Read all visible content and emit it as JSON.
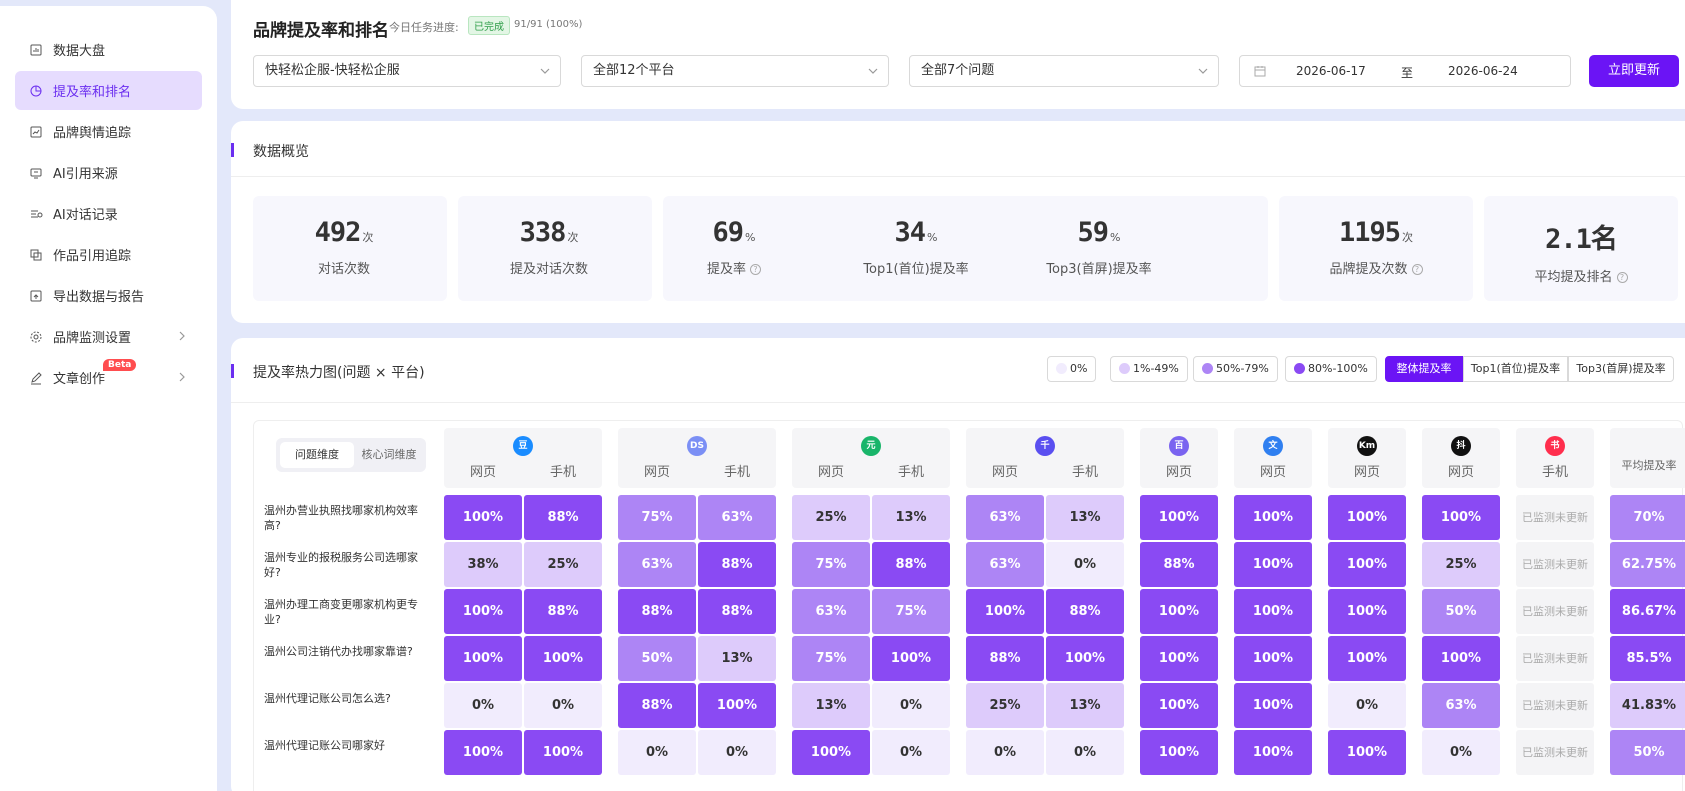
{
  "sidebar": {
    "items": [
      {
        "label": "数据大盘",
        "icon": "dashboard-icon",
        "active": false
      },
      {
        "label": "提及率和排名",
        "icon": "pie-chart-icon",
        "active": true
      },
      {
        "label": "品牌舆情追踪",
        "icon": "trend-icon",
        "active": false
      },
      {
        "label": "AI引用来源",
        "icon": "monitor-icon",
        "active": false
      },
      {
        "label": "AI对话记录",
        "icon": "chat-icon",
        "active": false
      },
      {
        "label": "作品引用追踪",
        "icon": "copy-icon",
        "active": false
      },
      {
        "label": "导出数据与报告",
        "icon": "export-icon",
        "active": false
      },
      {
        "label": "品牌监测设置",
        "icon": "gear-icon",
        "active": false,
        "has_children": true
      },
      {
        "label": "文章创作",
        "icon": "pen-icon",
        "active": false,
        "has_children": true,
        "badge": "Beta"
      }
    ]
  },
  "header": {
    "title": "品牌提及率和排名",
    "progress_label": "今日任务进度:",
    "status_badge": "已完成",
    "progress_value": "91/91 (100%)",
    "brand_select": "快轻松企服-快轻松企服",
    "platform_select": "全部12个平台",
    "question_select": "全部7个问题",
    "date_start": "2026-06-17",
    "date_sep": "至",
    "date_end": "2026-06-24",
    "update_button": "立即更新"
  },
  "overview": {
    "title": "数据概览",
    "stats": [
      {
        "value": "492",
        "unit": "次",
        "label": "对话次数",
        "help": false
      },
      {
        "value": "338",
        "unit": "次",
        "label": "提及对话次数",
        "help": false
      },
      {
        "value": "69",
        "unit": "%",
        "label": "提及率",
        "help": true
      },
      {
        "value": "34",
        "unit": "%",
        "label": "Top1(首位)提及率",
        "help": false
      },
      {
        "value": "59",
        "unit": "%",
        "label": "Top3(首屏)提及率",
        "help": false
      },
      {
        "value": "1195",
        "unit": "次",
        "label": "品牌提及次数",
        "help": true
      },
      {
        "value": "2.1名",
        "unit": "",
        "label": "平均提及排名",
        "help": true
      }
    ]
  },
  "heatmap": {
    "title": "提及率热力图(问题 × 平台)",
    "legend": [
      {
        "label": "0%",
        "color": "#f1ecfd"
      },
      {
        "label": "1%-49%",
        "color": "#ddcbfb"
      },
      {
        "label": "50%-79%",
        "color": "#ad85f5"
      },
      {
        "label": "80%-100%",
        "color": "#8a4af3"
      }
    ],
    "metric_tabs": [
      "整体提及率",
      "Top1(首位)提及率",
      "Top3(首屏)提及率"
    ],
    "dimension_tabs": [
      "问题维度",
      "核心词维度"
    ],
    "col_web": "网页",
    "col_mobile": "手机",
    "avg_header": "平均提及率",
    "not_monitored": "已监测未更新",
    "platforms": [
      {
        "logo": "豆",
        "color": "#1a8cff",
        "cols": [
          "网页",
          "手机"
        ]
      },
      {
        "logo": "DS",
        "color": "#7b8ff5",
        "cols": [
          "网页",
          "手机"
        ]
      },
      {
        "logo": "元",
        "color": "#19b56a",
        "cols": [
          "网页",
          "手机"
        ]
      },
      {
        "logo": "千",
        "color": "#5a4ff0",
        "cols": [
          "网页",
          "手机"
        ]
      },
      {
        "logo": "百",
        "color": "#7a63f0",
        "cols": [
          "网页"
        ]
      },
      {
        "logo": "文",
        "color": "#2f7ff0",
        "cols": [
          "网页"
        ]
      },
      {
        "logo": "Km",
        "color": "#111111",
        "cols": [
          "网页"
        ]
      },
      {
        "logo": "抖",
        "color": "#111111",
        "cols": [
          "网页"
        ]
      },
      {
        "logo": "书",
        "color": "#ff2e4d",
        "cols": [
          "手机"
        ]
      }
    ],
    "rows": [
      {
        "question": "温州办营业执照找哪家机构效率高?",
        "values": [
          "100%",
          "88%",
          "75%",
          "63%",
          "25%",
          "13%",
          "63%",
          "13%",
          "100%",
          "100%",
          "100%",
          "100%",
          null
        ],
        "avg": "70%"
      },
      {
        "question": "温州专业的报税服务公司选哪家好?",
        "values": [
          "38%",
          "25%",
          "63%",
          "88%",
          "75%",
          "88%",
          "63%",
          "0%",
          "88%",
          "100%",
          "100%",
          "25%",
          null
        ],
        "avg": "62.75%"
      },
      {
        "question": "温州办理工商变更哪家机构更专业?",
        "values": [
          "100%",
          "88%",
          "88%",
          "88%",
          "63%",
          "75%",
          "100%",
          "88%",
          "100%",
          "100%",
          "100%",
          "50%",
          null
        ],
        "avg": "86.67%"
      },
      {
        "question": "温州公司注销代办找哪家靠谱?",
        "values": [
          "100%",
          "100%",
          "50%",
          "13%",
          "75%",
          "100%",
          "88%",
          "100%",
          "100%",
          "100%",
          "100%",
          "100%",
          null
        ],
        "avg": "85.5%"
      },
      {
        "question": "温州代理记账公司怎么选?",
        "values": [
          "0%",
          "0%",
          "88%",
          "100%",
          "13%",
          "0%",
          "25%",
          "13%",
          "100%",
          "100%",
          "0%",
          "63%",
          null
        ],
        "avg": "41.83%"
      },
      {
        "question": "温州代理记账公司哪家好",
        "values": [
          "100%",
          "100%",
          "0%",
          "0%",
          "100%",
          "0%",
          "0%",
          "0%",
          "100%",
          "100%",
          "100%",
          "0%",
          null
        ],
        "avg": "50%"
      }
    ]
  }
}
